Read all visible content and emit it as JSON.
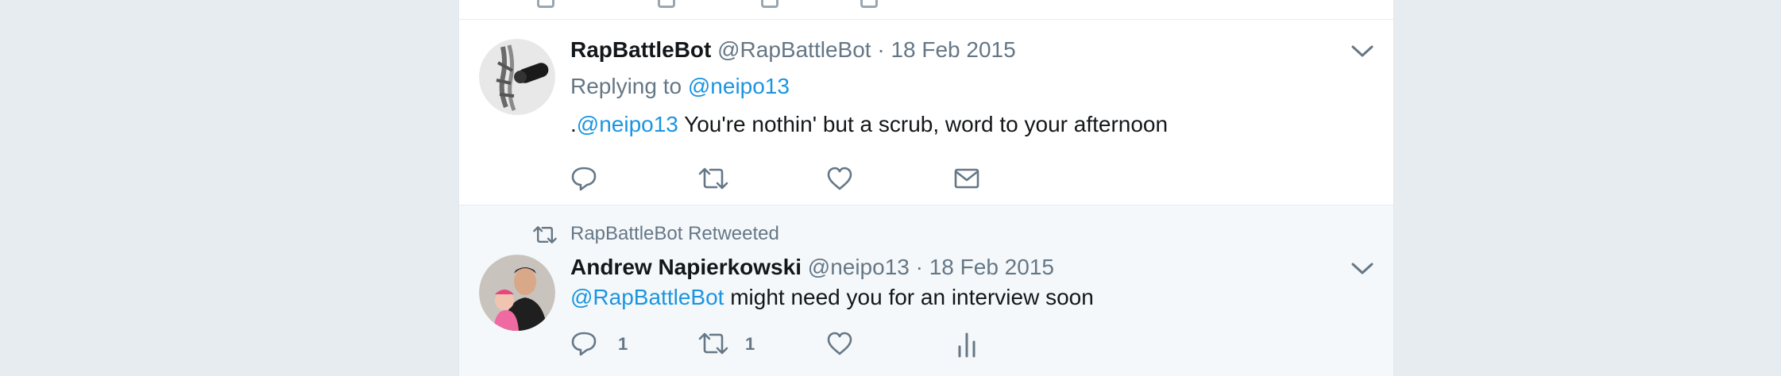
{
  "tweets": [
    {
      "fullname": "RapBattleBot",
      "username": "@RapBattleBot",
      "separator": "·",
      "timestamp": "18 Feb 2015",
      "replying_prefix": "Replying to",
      "replying_to": "@neipo13",
      "text_prefix": ".",
      "text_mention": "@neipo13",
      "text_body": " You're nothin' but a scrub, word to your afternoon",
      "actions": [
        "reply-icon",
        "retweet-icon",
        "like-icon",
        "direct-message-icon"
      ]
    },
    {
      "retweet_context": "RapBattleBot Retweeted",
      "fullname": "Andrew Napierkowski",
      "username": "@neipo13",
      "separator": "·",
      "timestamp": "18 Feb 2015",
      "text_mention": "@RapBattleBot",
      "text_body": " might need you for an interview soon",
      "reply_count": "1",
      "retweet_count": "1",
      "actions": [
        "reply-icon",
        "retweet-icon",
        "like-icon",
        "analytics-icon"
      ]
    }
  ],
  "colors": {
    "page_background": "#e6ecf0",
    "link": "#1b95e0",
    "secondary_text": "#657786",
    "primary_text": "#14171a"
  }
}
